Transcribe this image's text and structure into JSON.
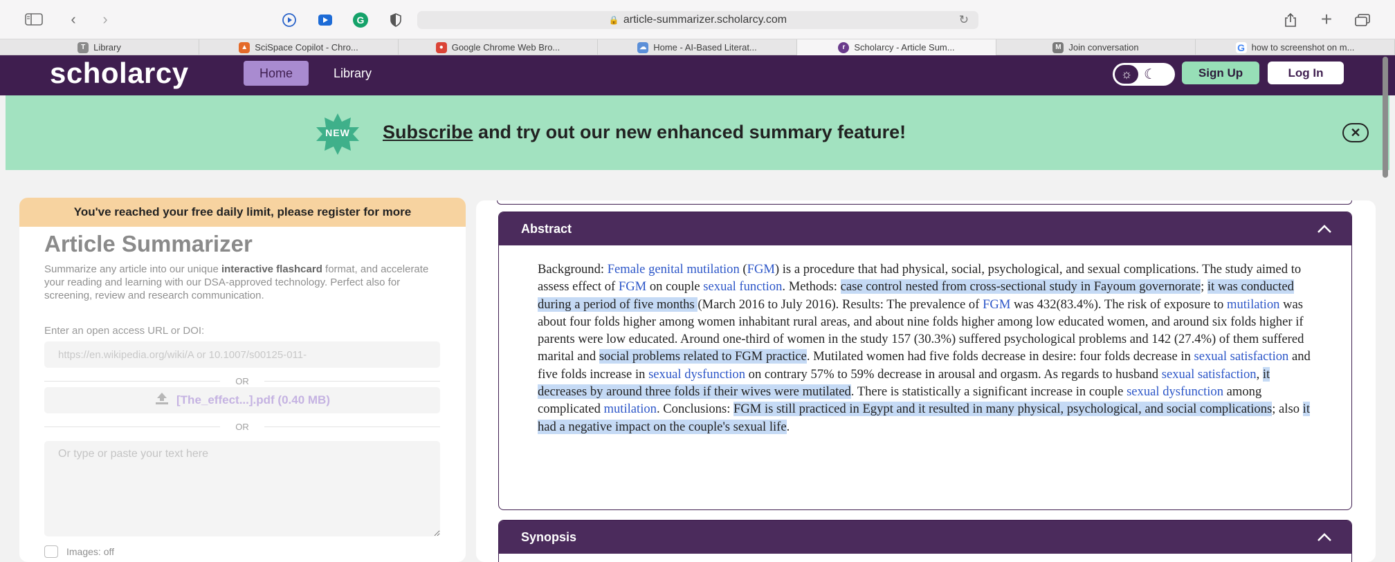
{
  "browser": {
    "url": "article-summarizer.scholarcy.com",
    "tabs": [
      {
        "label": "Library",
        "fav_color": "#8a8a8a",
        "fav_text": "T"
      },
      {
        "label": "SciSpace Copilot - Chro...",
        "fav_color": "#e46a2a",
        "fav_text": "▲"
      },
      {
        "label": "Google Chrome Web Bro...",
        "fav_color": "#db4437",
        "fav_text": "●"
      },
      {
        "label": "Home - AI-Based Literat...",
        "fav_color": "#5b8fd8",
        "fav_text": "☁"
      },
      {
        "label": "Scholarcy - Article Sum...",
        "fav_color": "#6a3b8c",
        "fav_text": "r",
        "active": true
      },
      {
        "label": "Join conversation",
        "fav_color": "#7a7a7a",
        "fav_text": "M"
      },
      {
        "label": "how to screenshot on m...",
        "fav_color": "#4285f4",
        "fav_text": "G"
      }
    ]
  },
  "header": {
    "logo": "scholarcy",
    "nav_home": "Home",
    "nav_library": "Library",
    "signup": "Sign Up",
    "login": "Log In"
  },
  "banner": {
    "badge": "NEW",
    "link_text": "Subscribe",
    "text": " and try out our new enhanced summary feature!"
  },
  "summarizer": {
    "limit_notice": "You've reached your free daily limit, please register for more",
    "title": "Article Summarizer",
    "desc_1": "Summarize any article into our unique ",
    "desc_bold": "interactive flashcard",
    "desc_2": " format, and accelerate your reading and learning with our DSA-approved technology. Perfect also for screening, review and research communication.",
    "url_label": "Enter an open access URL or DOI:",
    "url_placeholder": "https://en.wikipedia.org/wiki/A or 10.1007/s00125-011-",
    "or": "OR",
    "file_name": "[The_effect...].pdf (0.40 MB)",
    "text_placeholder": "Or type or paste your text here",
    "images_option": "Images: off"
  },
  "abstract": {
    "heading": "Abstract",
    "segments": [
      {
        "t": "Background: "
      },
      {
        "t": "Female genital mutilation",
        "k": true
      },
      {
        "t": " ("
      },
      {
        "t": "FGM",
        "k": true
      },
      {
        "t": ") is a procedure that had physical, social, psychological, and sexual complications. The study aimed to assess effect of "
      },
      {
        "t": "FGM",
        "k": true
      },
      {
        "t": " on couple "
      },
      {
        "t": "sexual function",
        "k": true
      },
      {
        "t": ". Methods: "
      },
      {
        "t": "case control nested from cross-sectional study in Fayoum governorate",
        "h": true
      },
      {
        "t": "; "
      },
      {
        "t": "it was conducted during a period of five months ",
        "h": true
      },
      {
        "t": "(March 2016 to July 2016). Results: The prevalence of "
      },
      {
        "t": "FGM",
        "k": true
      },
      {
        "t": " was 432(83.4%). The risk of exposure to "
      },
      {
        "t": "mutilation",
        "k": true
      },
      {
        "t": " was about four folds higher among women inhabitant rural areas, and about nine folds higher among low educated women, and around six folds higher if parents were low educated. Around one-third of women in the study 157 (30.3%) suffered psychological problems and 142 (27.4%) of them suffered marital and "
      },
      {
        "t": "social problems related to FGM practice",
        "h": true
      },
      {
        "t": ". Mutilated women had five folds decrease in desire: four folds decrease in "
      },
      {
        "t": "sexual satisfaction",
        "k": true
      },
      {
        "t": " and five folds increase in "
      },
      {
        "t": "sexual dysfunction",
        "k": true
      },
      {
        "t": " on contrary 57% to 59% decrease in arousal and orgasm. As regards to husband "
      },
      {
        "t": "sexual satisfaction",
        "k": true
      },
      {
        "t": ", "
      },
      {
        "t": "it decreases by around three folds if their wives were mutilated",
        "h": true
      },
      {
        "t": ". There is statistically a significant increase in couple "
      },
      {
        "t": "sexual dysfunction",
        "k": true
      },
      {
        "t": " among complicated "
      },
      {
        "t": "mutilation",
        "k": true
      },
      {
        "t": ". Conclusions: "
      },
      {
        "t": "FGM is still practiced in Egypt and it resulted in many physical, psychological, and social complications",
        "h": true
      },
      {
        "t": "; also "
      },
      {
        "t": "it had a negative impact on the couple's sexual life",
        "h": true
      },
      {
        "t": "."
      }
    ]
  },
  "synopsis": {
    "heading": "Synopsis"
  },
  "colors": {
    "brand": "#3f1e4f",
    "card_header": "#4b2b5c",
    "banner": "#a2e2c0",
    "accent_green": "#97dfb7",
    "home_tab": "#a98bd0",
    "limit_bg": "#f7d3a0",
    "keyword": "#2c56c8",
    "highlight": "#c5daf5"
  }
}
